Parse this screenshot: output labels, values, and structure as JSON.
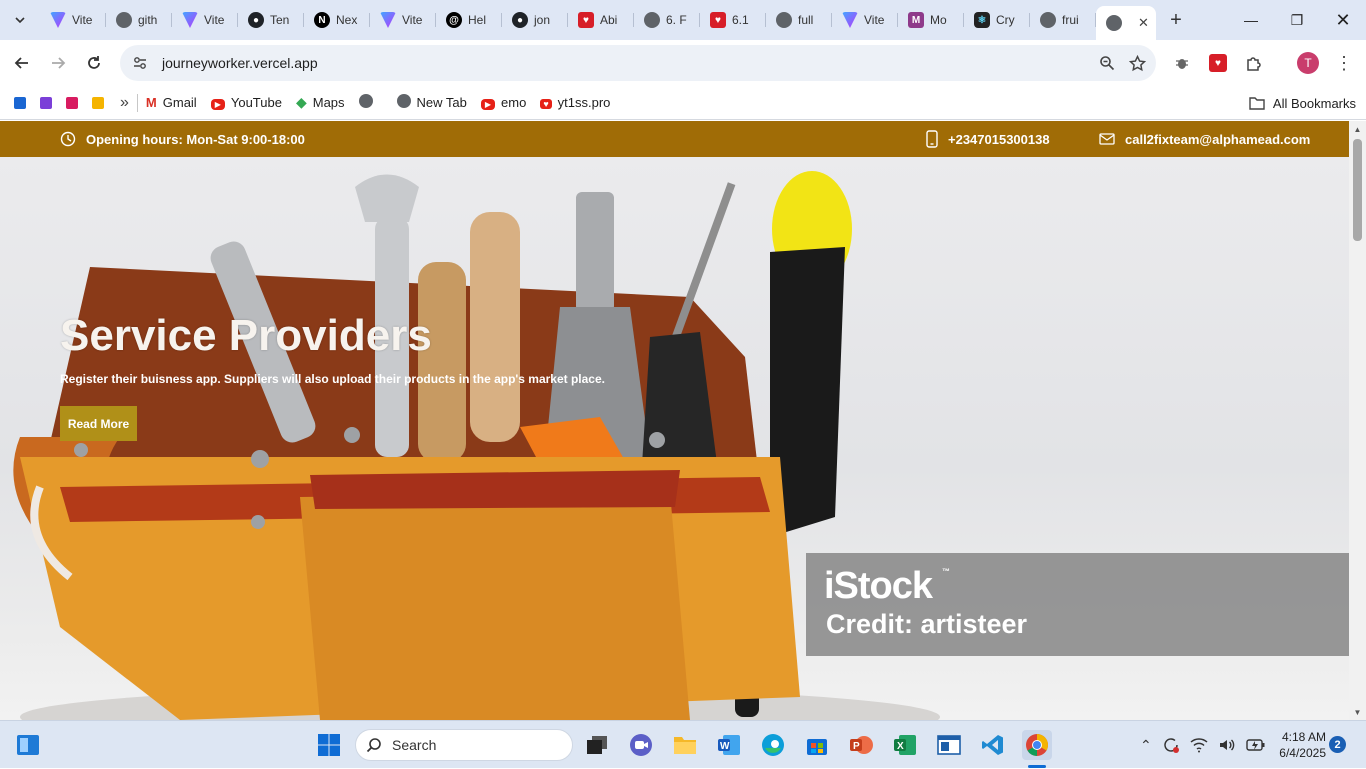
{
  "browser": {
    "tabs": [
      {
        "label": "Vite",
        "icon": "vite-icon"
      },
      {
        "label": "gith",
        "icon": "globe-icon"
      },
      {
        "label": "Vite",
        "icon": "vite-icon"
      },
      {
        "label": "Ten",
        "icon": "github-icon"
      },
      {
        "label": "Nex",
        "icon": "nextjs-icon"
      },
      {
        "label": "Vite",
        "icon": "vite-icon"
      },
      {
        "label": "Hel",
        "icon": "threads-icon"
      },
      {
        "label": "jon",
        "icon": "github-icon"
      },
      {
        "label": "Abi",
        "icon": "red-app-icon"
      },
      {
        "label": "6. F",
        "icon": "globe-icon"
      },
      {
        "label": "6.1",
        "icon": "red-app-icon"
      },
      {
        "label": "full",
        "icon": "globe-icon"
      },
      {
        "label": "Vite",
        "icon": "vite-icon"
      },
      {
        "label": "Mo",
        "icon": "mo-icon"
      },
      {
        "label": "Cry",
        "icon": "react-icon"
      },
      {
        "label": "frui",
        "icon": "globe-icon"
      }
    ],
    "active_tab_icon": "globe-icon",
    "url": "journeyworker.vercel.app",
    "profile_initial": "T",
    "bookmarks": [
      {
        "label": "Gmail",
        "icon": "gmail-icon"
      },
      {
        "label": "YouTube",
        "icon": "youtube-icon"
      },
      {
        "label": "Maps",
        "icon": "maps-icon"
      },
      {
        "label": "",
        "icon": "globe-icon"
      },
      {
        "label": "New Tab",
        "icon": "globe-icon"
      },
      {
        "label": "emo",
        "icon": "youtube-icon"
      },
      {
        "label": "yt1ss.pro",
        "icon": "red-heart-icon"
      }
    ],
    "all_bookmarks_label": "All Bookmarks"
  },
  "site": {
    "topbar": {
      "hours": "Opening hours: Mon-Sat 9:00-18:00",
      "phone": "+2347015300138",
      "email": "call2fixteam@alphamead.com"
    },
    "hero": {
      "title": "Service Providers",
      "subtitle": "Register their buisness app. Suppliers will also upload their products in the app's market place.",
      "button": "Read More",
      "watermark_brand": "iStock",
      "watermark_credit": "Credit: artisteer"
    },
    "colors": {
      "topbar": "#a06c06",
      "button": "#b09018"
    }
  },
  "taskbar": {
    "search_placeholder": "Search",
    "time": "4:18 AM",
    "date": "6/4/2025",
    "notifications": "2"
  }
}
